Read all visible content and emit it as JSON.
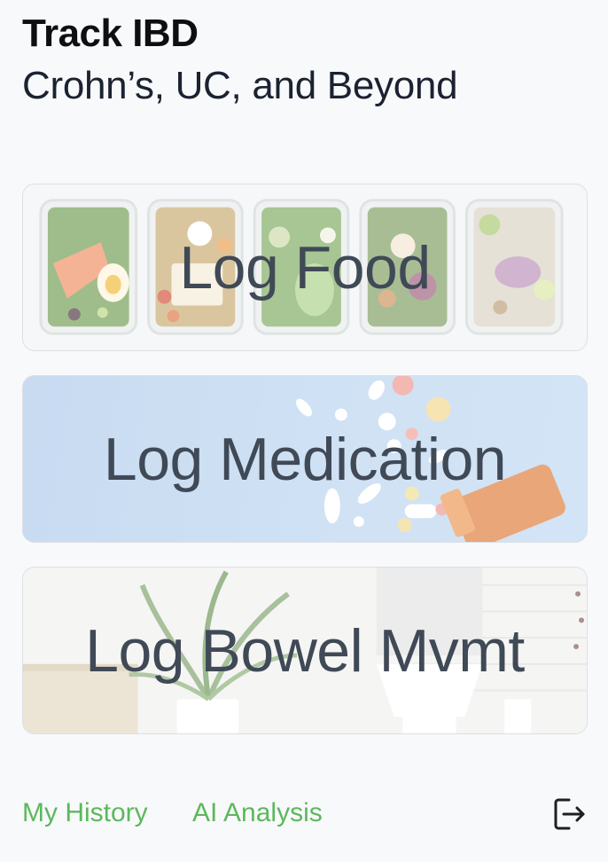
{
  "header": {
    "title": "Track IBD",
    "subtitle": "Crohn’s, UC, and Beyond"
  },
  "cards": {
    "food": {
      "label": "Log Food"
    },
    "medication": {
      "label": "Log Medication"
    },
    "bowel": {
      "label": "Log Bowel Mvmt"
    }
  },
  "footer": {
    "history_label": "My History",
    "ai_label": "AI Analysis",
    "logout_icon": "logout-icon"
  },
  "colors": {
    "link": "#5cb85c",
    "card_text": "#404956",
    "title": "#0d0f12"
  }
}
